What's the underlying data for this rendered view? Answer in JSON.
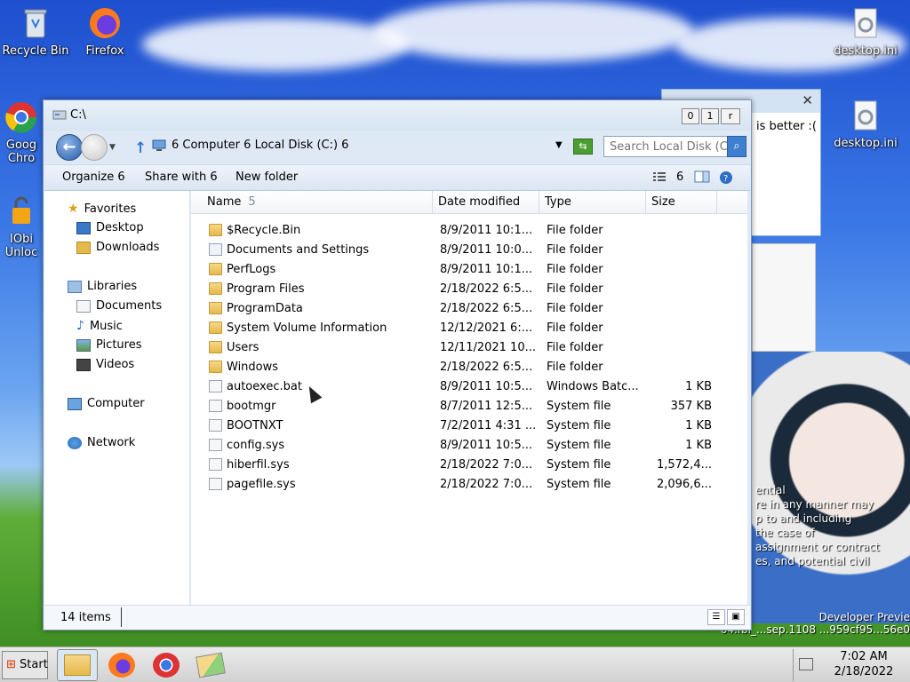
{
  "desktop": {
    "icons": [
      {
        "label": "Recycle Bin",
        "icon": "recycle-bin-icon"
      },
      {
        "label": "Firefox",
        "icon": "firefox-icon"
      },
      {
        "label": "Goog Chro",
        "icon": "chrome-icon"
      },
      {
        "label": "IObi Unloc",
        "icon": "iobit-unlocker-icon"
      },
      {
        "label": "desktop.ini",
        "icon": "settings-file-icon"
      },
      {
        "label": "desktop.ini",
        "icon": "settings-file-icon"
      }
    ],
    "background_window": {
      "text": "is better :("
    },
    "overlay_text": "ential\nre in any manner may\np to and including\nthe case of\nassignment or contract\nes, and potential civil",
    "watermark": "Developer Previe\n64.fbl_...sep.1108 ...959cf95...56e0"
  },
  "explorer": {
    "title": "C:\\",
    "window_buttons": {
      "minimize": "0",
      "maximize": "1",
      "close": "r"
    },
    "address": {
      "crumbs": "6  Computer  6  Local Disk (C:)  6",
      "dropdown_icon": "chevron-down-icon"
    },
    "search": {
      "placeholder": "Search Local Disk (C:)",
      "value": "Search Local Disk (C:)"
    },
    "toolbar": {
      "organize": "Organize  6",
      "share_with": "Share with  6",
      "new_folder": "New folder",
      "views_arrow": "6"
    },
    "nav": {
      "favorites": "Favorites",
      "desktop": "Desktop",
      "downloads": "Downloads",
      "libraries": "Libraries",
      "documents": "Documents",
      "music": "Music",
      "pictures": "Pictures",
      "videos": "Videos",
      "computer": "Computer",
      "network": "Network"
    },
    "columns": {
      "name": "Name",
      "sort_marker": "5",
      "date": "Date modified",
      "type": "Type",
      "size": "Size"
    },
    "files": [
      {
        "name": "$Recycle.Bin",
        "date": "8/9/2011 10:1...",
        "type": "File folder",
        "size": "",
        "kind": "folder"
      },
      {
        "name": "Documents and Settings",
        "date": "8/9/2011 10:0...",
        "type": "File folder",
        "size": "",
        "kind": "link"
      },
      {
        "name": "PerfLogs",
        "date": "8/9/2011 10:1...",
        "type": "File folder",
        "size": "",
        "kind": "folder"
      },
      {
        "name": "Program Files",
        "date": "2/18/2022 6:5...",
        "type": "File folder",
        "size": "",
        "kind": "folder"
      },
      {
        "name": "ProgramData",
        "date": "2/18/2022 6:5...",
        "type": "File folder",
        "size": "",
        "kind": "folder"
      },
      {
        "name": "System Volume Information",
        "date": "12/12/2021 6:...",
        "type": "File folder",
        "size": "",
        "kind": "folder"
      },
      {
        "name": "Users",
        "date": "12/11/2021 10...",
        "type": "File folder",
        "size": "",
        "kind": "folder"
      },
      {
        "name": "Windows",
        "date": "2/18/2022 6:5...",
        "type": "File folder",
        "size": "",
        "kind": "folder"
      },
      {
        "name": "autoexec.bat",
        "date": "8/9/2011 10:5...",
        "type": "Windows Batc...",
        "size": "1 KB",
        "kind": "file"
      },
      {
        "name": "bootmgr",
        "date": "8/7/2011 12:5...",
        "type": "System file",
        "size": "357 KB",
        "kind": "file"
      },
      {
        "name": "BOOTNXT",
        "date": "7/2/2011 4:31 ...",
        "type": "System file",
        "size": "1 KB",
        "kind": "file"
      },
      {
        "name": "config.sys",
        "date": "8/9/2011 10:5...",
        "type": "System file",
        "size": "1 KB",
        "kind": "file"
      },
      {
        "name": "hiberfil.sys",
        "date": "2/18/2022 7:0...",
        "type": "System file",
        "size": "1,572,4...",
        "kind": "file"
      },
      {
        "name": "pagefile.sys",
        "date": "2/18/2022 7:0...",
        "type": "System file",
        "size": "2,096,6...",
        "kind": "file"
      }
    ],
    "status": {
      "item_count": "14 items"
    }
  },
  "taskbar": {
    "start_label": "Start",
    "apps": [
      "file-explorer-icon",
      "firefox-icon",
      "chrome-icon",
      "folder-pair-icon"
    ],
    "clock": {
      "time": "7:02 AM",
      "date": "2/18/2022"
    }
  },
  "colors": {
    "accent": "#3f7fd0",
    "window_frame": "#dfe9f5",
    "folder": "#e5b94c"
  }
}
